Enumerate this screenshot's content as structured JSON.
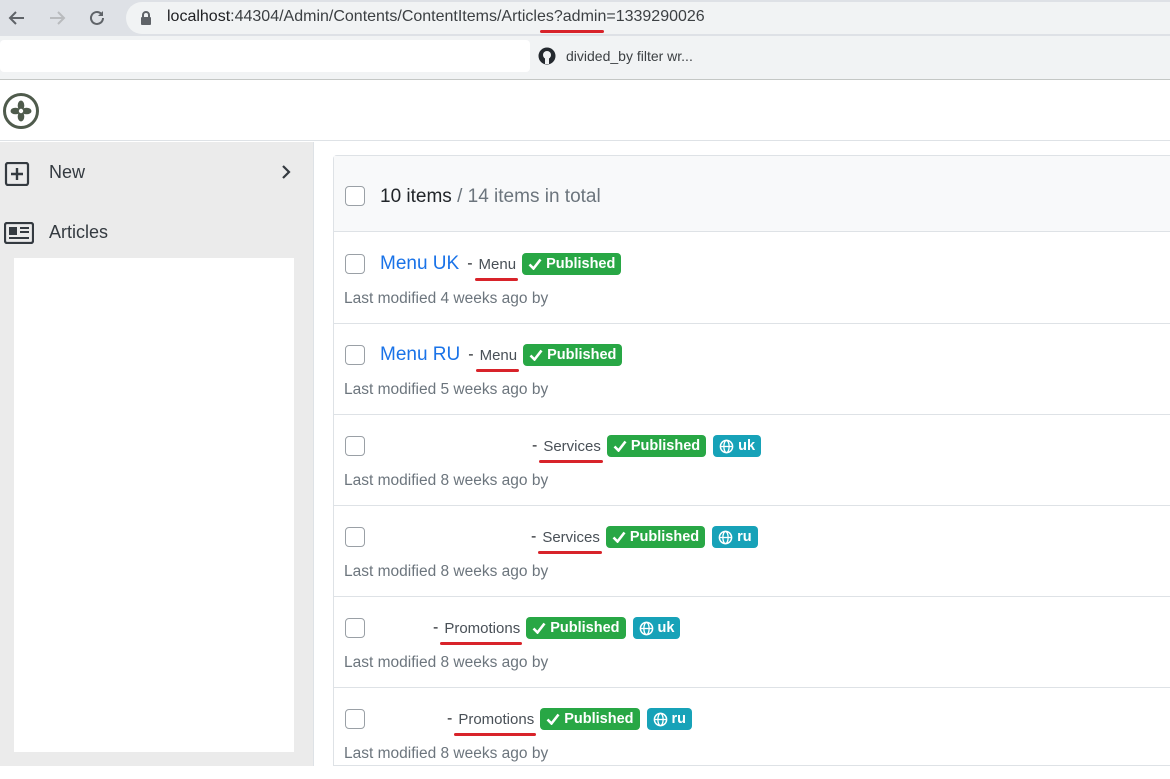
{
  "browser": {
    "url_host": "localhost",
    "url_path": ":44304/Admin/Contents/ContentItems/Articles?admin=1339290026",
    "bookmark_label": "divided_by filter wr..."
  },
  "sidebar": {
    "items": [
      {
        "label": "New",
        "icon": "plus-square-icon"
      },
      {
        "label": "Articles",
        "icon": "newspaper-icon"
      }
    ]
  },
  "list": {
    "count_text": "10 items",
    "total_text": " / 14 items in total",
    "rows": [
      {
        "title": "Menu UK",
        "type": "Menu",
        "status": "Published",
        "lang": "",
        "meta": "Last modified 4 weeks ago by"
      },
      {
        "title": "Menu RU",
        "type": "Menu",
        "status": "Published",
        "lang": "",
        "meta": "Last modified 5 weeks ago by"
      },
      {
        "title": "",
        "type": "Services",
        "status": "Published",
        "lang": "uk",
        "meta": "Last modified 8 weeks ago by"
      },
      {
        "title": "",
        "type": "Services",
        "status": "Published",
        "lang": "ru",
        "meta": "Last modified 8 weeks ago by"
      },
      {
        "title": "",
        "type": "Promotions",
        "status": "Published",
        "lang": "uk",
        "meta": "Last modified 8 weeks ago by"
      },
      {
        "title": "",
        "type": "Promotions",
        "status": "Published",
        "lang": "ru",
        "meta": "Last modified 8 weeks ago by"
      }
    ]
  }
}
